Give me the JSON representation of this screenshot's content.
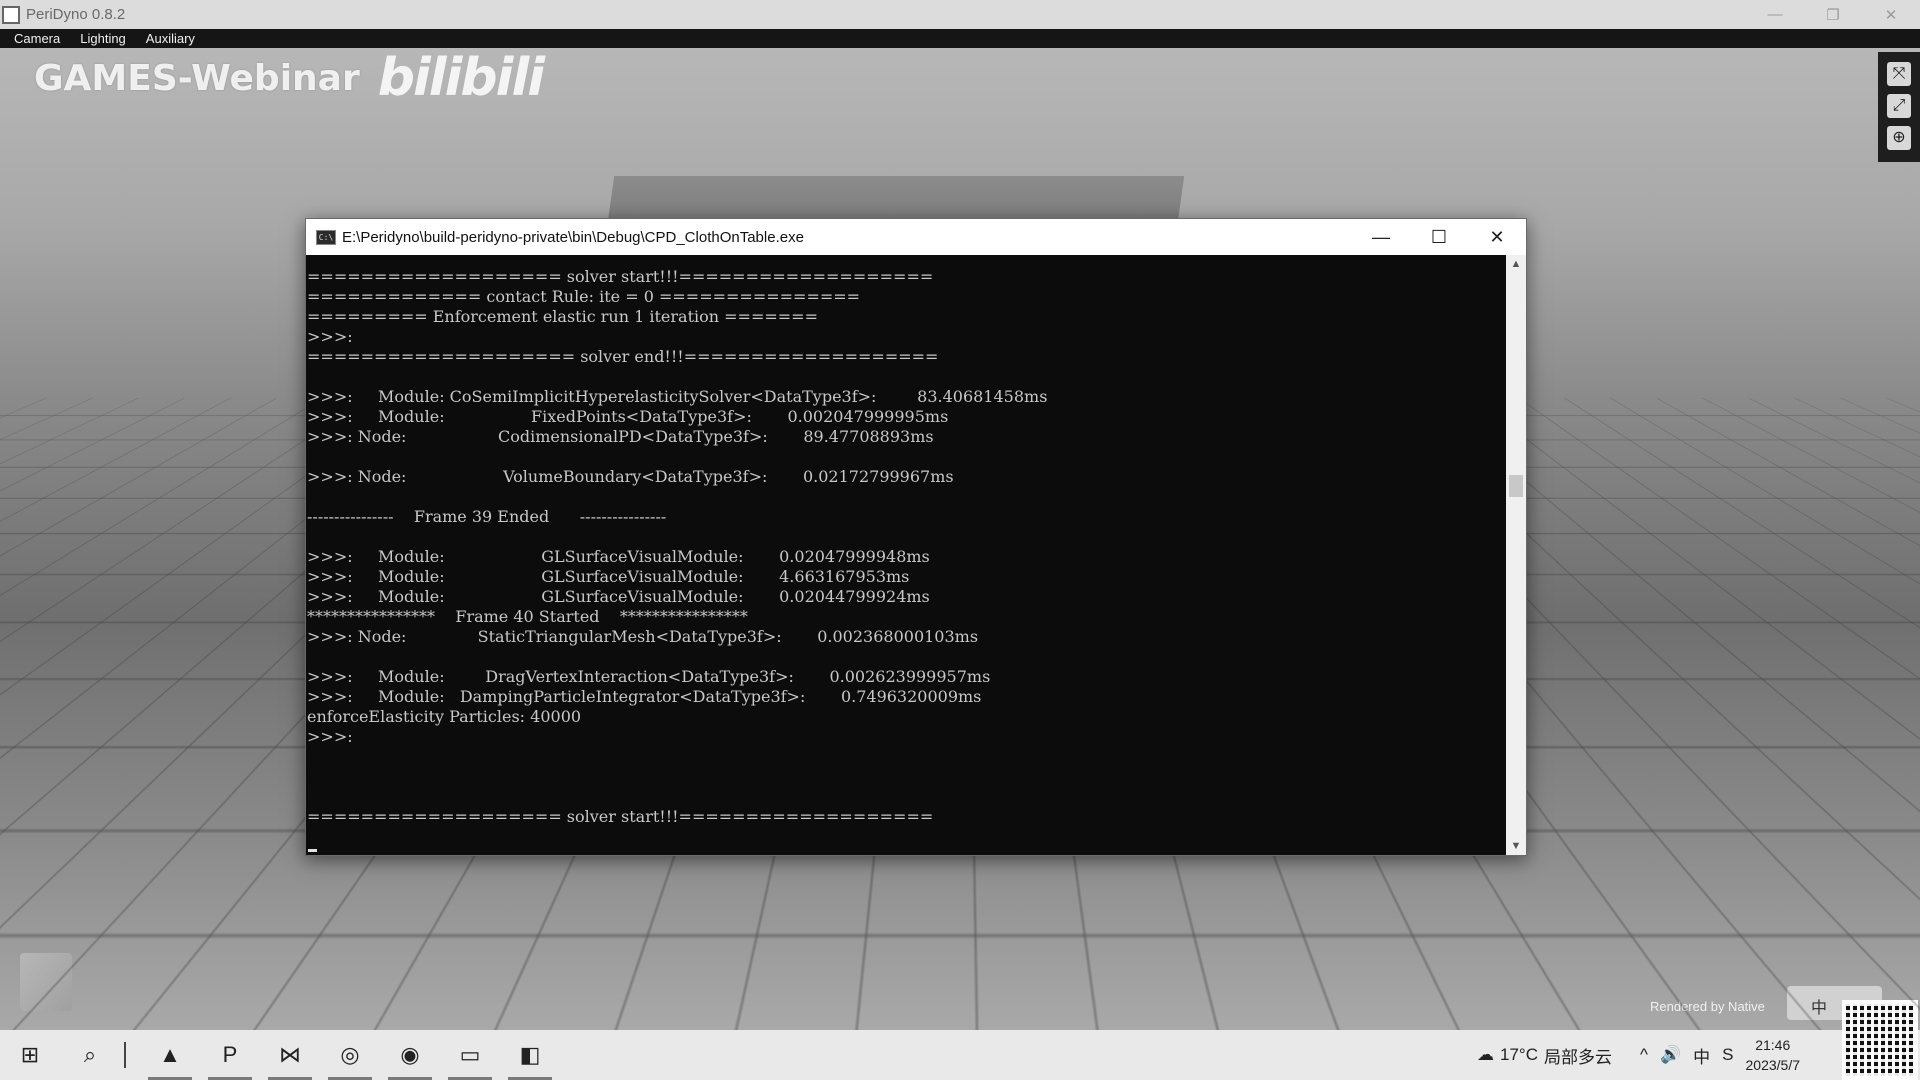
{
  "app": {
    "title": "PeriDyno 0.8.2",
    "window_controls": {
      "minimize": "—",
      "restore": "❐",
      "close": "✕"
    }
  },
  "menu": [
    "Camera",
    "Lighting",
    "Auxiliary"
  ],
  "watermark": {
    "text": "GAMES-Webinar",
    "logo_text": "bilibili"
  },
  "viewport": {
    "rendered_by": "Rendered by Native",
    "ime_indicator": "中",
    "toolbar_icons": [
      "fullscreen-icon",
      "expand-icon",
      "globe-icon"
    ]
  },
  "console": {
    "title": "E:\\Peridyno\\build-peridyno-private\\bin\\Debug\\CPD_ClothOnTable.exe",
    "controls": {
      "minimize": "—",
      "maximize": "☐",
      "close": "✕"
    },
    "lines": [
      "=================== solver start!!!===================",
      "============= contact Rule: ite = 0 ===============",
      "========= Enforcement elastic run 1 iteration =======",
      ">>>:",
      "==================== solver end!!!===================",
      "",
      ">>>:     Module: CoSemiImplicitHyperelasticitySolver<DataType3f>:        83.40681458ms",
      ">>>:     Module:                 FixedPoints<DataType3f>:       0.002047999995ms",
      ">>>: Node:                  CodimensionalPD<DataType3f>:       89.47708893ms",
      "",
      ">>>: Node:                   VolumeBoundary<DataType3f>:       0.02172799967ms",
      "",
      "----------------    Frame 39 Ended      ----------------",
      "",
      ">>>:     Module:                   GLSurfaceVisualModule:       0.02047999948ms",
      ">>>:     Module:                   GLSurfaceVisualModule:       4.663167953ms",
      ">>>:     Module:                   GLSurfaceVisualModule:       0.02044799924ms",
      "****************    Frame 40 Started    ****************",
      ">>>: Node:              StaticTriangularMesh<DataType3f>:       0.002368000103ms",
      "",
      ">>>:     Module:        DragVertexInteraction<DataType3f>:       0.002623999957ms",
      ">>>:     Module:   DampingParticleIntegrator<DataType3f>:       0.7496320009ms",
      "enforceElasticity Particles: 40000",
      ">>>:",
      "",
      "",
      "",
      "=================== solver start!!!==================="
    ]
  },
  "taskbar": {
    "apps": [
      {
        "name": "start-button",
        "glyph": "⊞"
      },
      {
        "name": "search-button",
        "glyph": "⌕"
      },
      {
        "name": "app-autodesk",
        "glyph": "▲"
      },
      {
        "name": "app-powerpoint",
        "glyph": "P"
      },
      {
        "name": "app-visual-studio",
        "glyph": "⋈"
      },
      {
        "name": "app-chrome",
        "glyph": "◎"
      },
      {
        "name": "app-obs",
        "glyph": "◉"
      },
      {
        "name": "app-console",
        "glyph": "▭"
      },
      {
        "name": "app-peridyno",
        "glyph": "◧"
      }
    ],
    "weather": {
      "temp": "17°C",
      "desc": "局部多云"
    },
    "tray_icons": [
      "^",
      "🔊",
      "中",
      "S"
    ],
    "time": "21:46",
    "date": "2023/5/7"
  }
}
